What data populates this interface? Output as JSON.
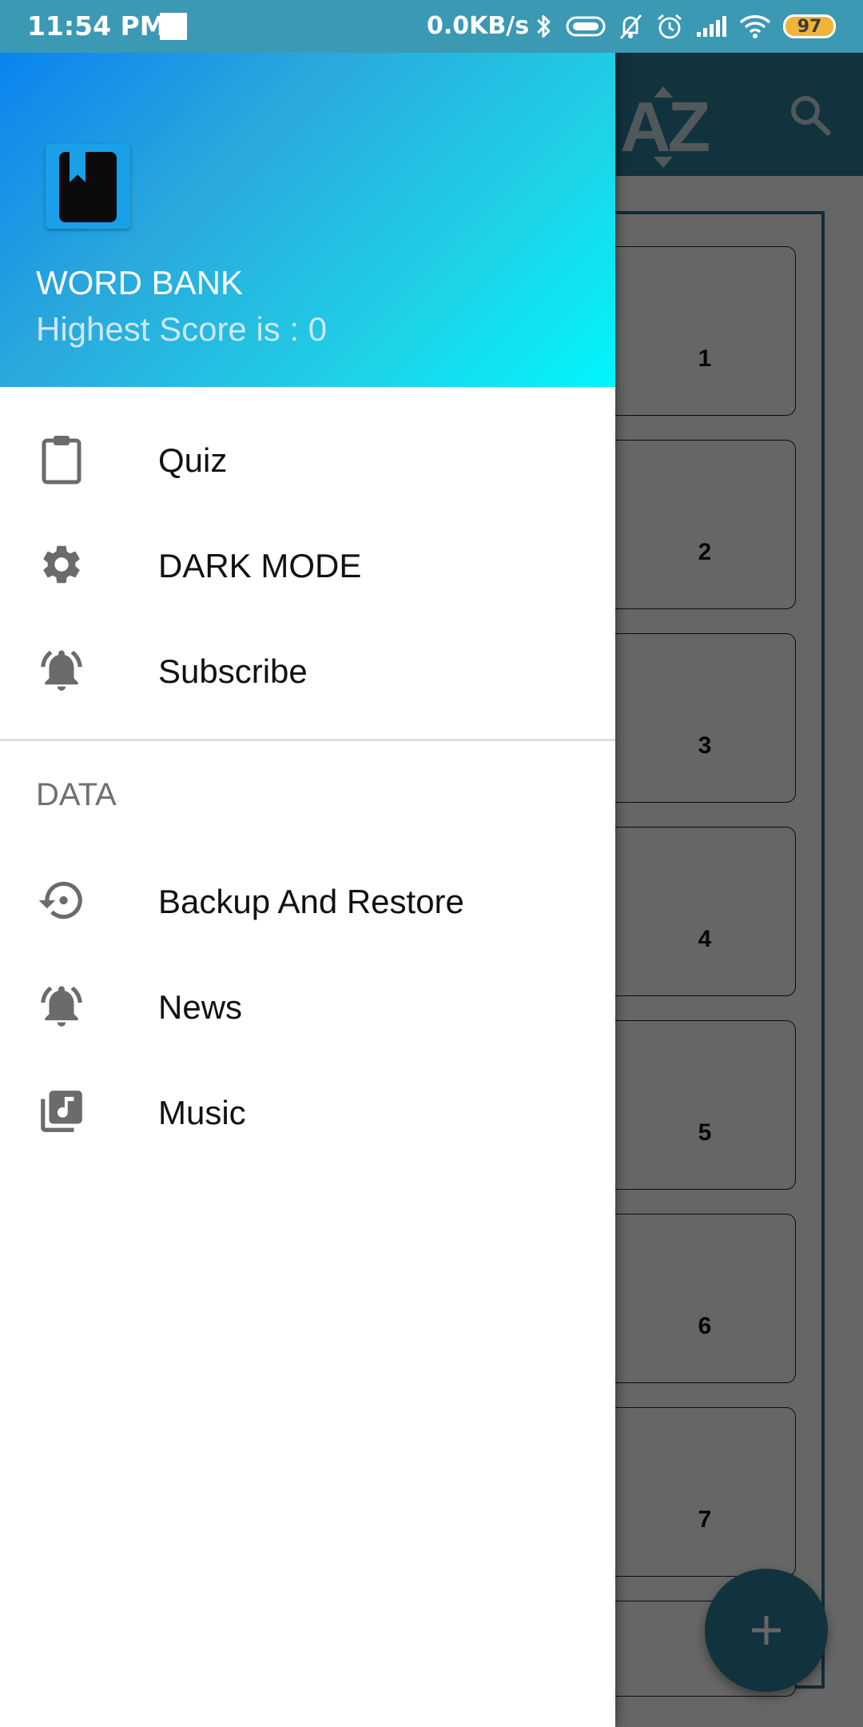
{
  "status_bar": {
    "time": "11:54 PM",
    "network_speed": "0.0KB/s",
    "battery_level": "97",
    "icons": [
      "bluetooth-icon",
      "vpn-pill-icon",
      "mute-bell-icon",
      "alarm-icon",
      "signal-icon",
      "wifi-icon",
      "battery-icon"
    ]
  },
  "drawer": {
    "header": {
      "title": "WORD BANK",
      "subtitle": "Highest Score is : 0",
      "logo_icon": "book-bookmark-icon",
      "gradient": [
        "#0a84f0",
        "#00f6fb"
      ]
    },
    "items": [
      {
        "label": "Quiz",
        "icon": "clipboard-icon"
      },
      {
        "label": "DARK MODE",
        "icon": "gear-icon"
      },
      {
        "label": "Subscribe",
        "icon": "bell-ring-icon"
      }
    ],
    "section": {
      "label": "DATA",
      "items": [
        {
          "label": "Backup And Restore",
          "icon": "restore-icon"
        },
        {
          "label": "News",
          "icon": "bell-ring-icon"
        },
        {
          "label": "Music",
          "icon": "music-library-icon"
        }
      ]
    }
  },
  "background_app": {
    "toolbar_icons": [
      "sort-az-icon",
      "search-icon"
    ],
    "cards": [
      "1",
      "2",
      "3",
      "4",
      "5",
      "6",
      "7"
    ],
    "fab_icon": "plus-icon",
    "accent_color": "#2b7f99"
  }
}
